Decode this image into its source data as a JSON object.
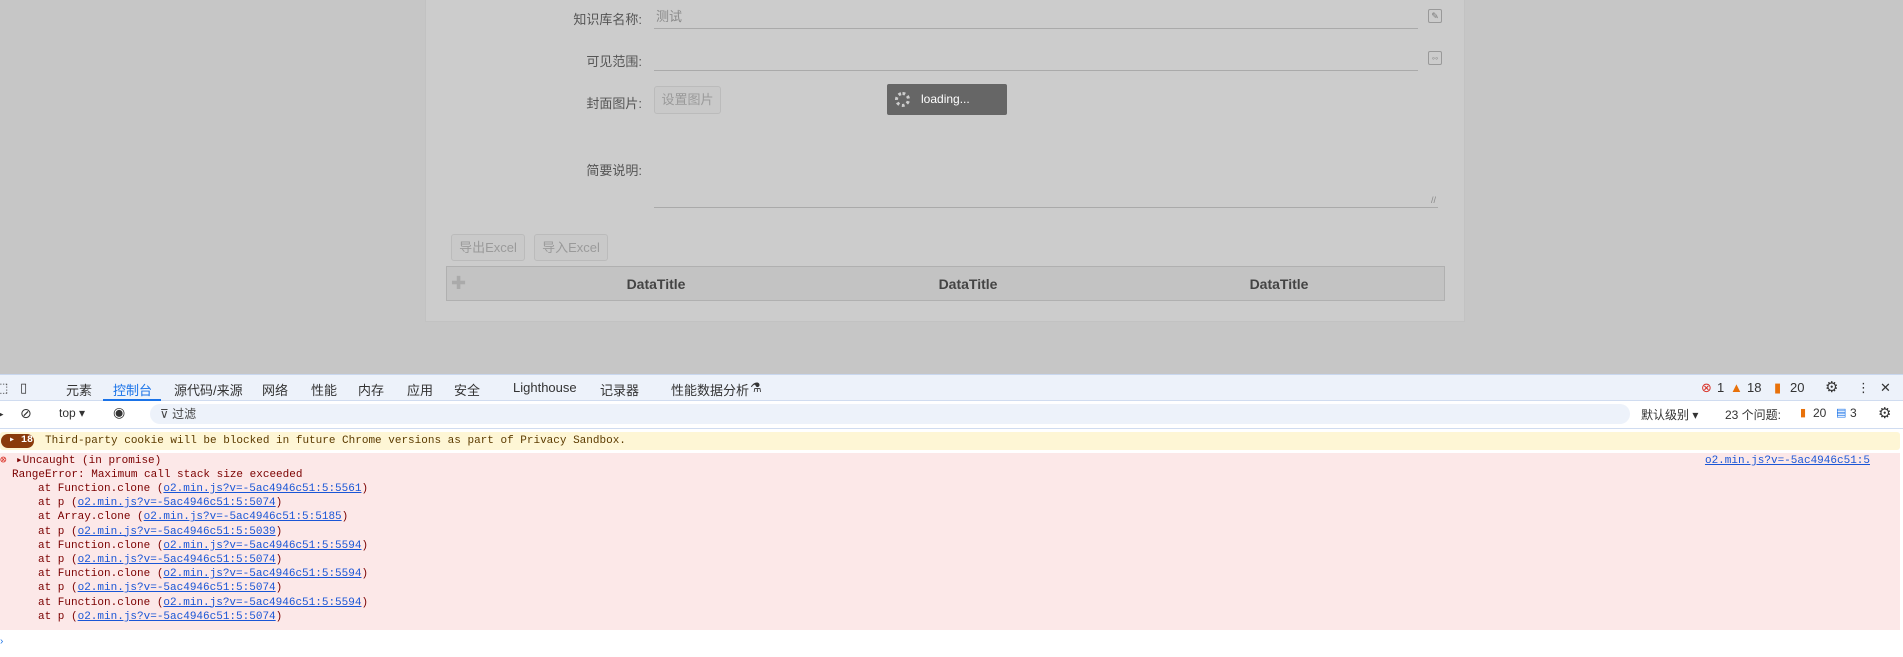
{
  "form": {
    "name_label": "知识库名称:",
    "name_value": "测试",
    "scope_label": "可见范围:",
    "scope_value": "",
    "cover_label": "封面图片:",
    "cover_button": "设置图片",
    "desc_label": "简要说明:",
    "loading_text": "loading...",
    "export_button": "导出Excel",
    "import_button": "导入Excel",
    "table_headers": [
      "DataTitle",
      "DataTitle",
      "DataTitle"
    ]
  },
  "devtools": {
    "tabs": [
      "元素",
      "控制台",
      "源代码/来源",
      "网络",
      "性能",
      "内存",
      "应用",
      "安全",
      "Lighthouse",
      "记录器",
      "性能数据分析"
    ],
    "active_tab": "控制台",
    "error_count": "1",
    "warning_count": "18",
    "issue_count": "20",
    "context": "top",
    "filter_placeholder": "过滤",
    "level": "默认级别",
    "issues_label": "23 个问题:",
    "issues_warn": "20",
    "issues_info": "3",
    "warning_badge": "18",
    "warning_message": "Third-party cookie will be blocked in future Chrome versions as part of Privacy Sandbox.",
    "error_title": "Uncaught (in promise)",
    "error_source": "o2.min.js?v=-5ac4946c51:5",
    "error_message": "RangeError: Maximum call stack size exceeded",
    "stack": [
      {
        "prefix": "at Function.clone (",
        "link": "o2.min.js?v=-5ac4946c51:5:5561"
      },
      {
        "prefix": "at p (",
        "link": "o2.min.js?v=-5ac4946c51:5:5074"
      },
      {
        "prefix": "at Array.clone (",
        "link": "o2.min.js?v=-5ac4946c51:5:5185"
      },
      {
        "prefix": "at p (",
        "link": "o2.min.js?v=-5ac4946c51:5:5039"
      },
      {
        "prefix": "at Function.clone (",
        "link": "o2.min.js?v=-5ac4946c51:5:5594"
      },
      {
        "prefix": "at p (",
        "link": "o2.min.js?v=-5ac4946c51:5:5074"
      },
      {
        "prefix": "at Function.clone (",
        "link": "o2.min.js?v=-5ac4946c51:5:5594"
      },
      {
        "prefix": "at p (",
        "link": "o2.min.js?v=-5ac4946c51:5:5074"
      },
      {
        "prefix": "at Function.clone (",
        "link": "o2.min.js?v=-5ac4946c51:5:5594"
      },
      {
        "prefix": "at p (",
        "link": "o2.min.js?v=-5ac4946c51:5:5074"
      }
    ],
    "stack_suffix": ")"
  }
}
